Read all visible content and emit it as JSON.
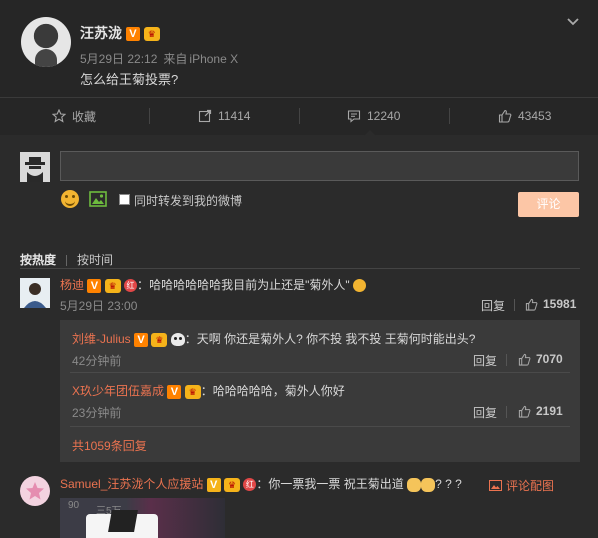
{
  "post": {
    "author": "汪苏泷",
    "verified_badge": "V",
    "date": "5月29日 22:12",
    "source_prefix": "来自",
    "source": "iPhone X",
    "text": "怎么给王菊投票?"
  },
  "actions": {
    "favorite": "收藏",
    "repost_count": "11414",
    "comment_count": "12240",
    "like_count": "43453"
  },
  "compose": {
    "input_value": "",
    "forward_label": "同时转发到我的微博",
    "submit_label": "评论"
  },
  "sort": {
    "by_heat": "按热度",
    "by_time": "按时间"
  },
  "comments": [
    {
      "name": "杨迪",
      "text": "哈哈哈哈哈哈我目前为止还是\"菊外人\"",
      "time": "5月29日 23:00",
      "reply_label": "回复",
      "likes": "15981",
      "replies": [
        {
          "name": "刘维-Julius",
          "text": "天啊 你还是菊外人? 你不投 我不投 王菊何时能出头?",
          "time": "42分钟前",
          "reply_label": "回复",
          "likes": "7070"
        },
        {
          "name": "X玖少年团伍嘉成",
          "text": "哈哈哈哈哈，菊外人你好",
          "time": "23分钟前",
          "reply_label": "回复",
          "likes": "2191"
        }
      ],
      "total_replies": "共1059条回复"
    },
    {
      "name": "Samuel_汪苏泷个人应援站",
      "text": "你一票我一票 祝王菊出道",
      "text_suffix": "? ? ?",
      "pic_tag": "评论配图",
      "thumb_text_1": "90",
      "thumb_text_2": "三5万"
    }
  ],
  "colors": {
    "background": "#2b2b2b",
    "name_accent": "#eb7350",
    "submit_button": "#fcc6a6",
    "verified": "#ff8200"
  }
}
